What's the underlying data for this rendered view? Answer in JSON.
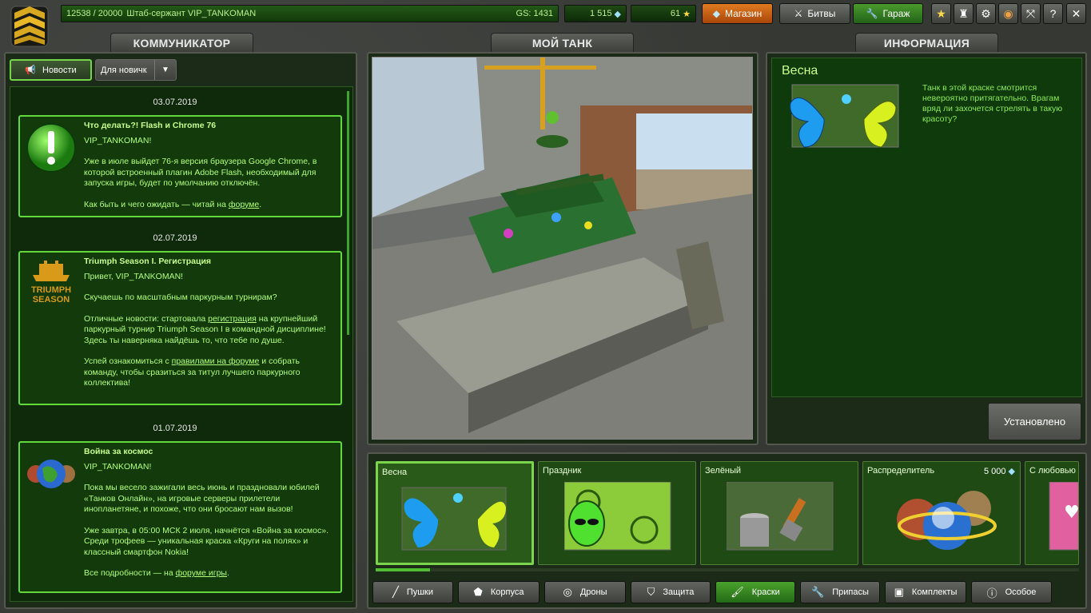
{
  "header": {
    "xp": "12538 / 20000",
    "player": "Штаб-сержант VIP_TANKOMAN",
    "gs": "GS: 1431",
    "crystals": "1 515",
    "stars": "61",
    "shop_label": "Магазин",
    "battles_label": "Битвы",
    "garage_label": "Гараж"
  },
  "tabs": {
    "communicator": "КОММУНИКАТОР",
    "my_tank": "МОЙ ТАНК",
    "information": "ИНФОРМАЦИЯ"
  },
  "communicator": {
    "news_button": "Новости",
    "filter_value": "Для новичк",
    "posts": [
      {
        "date": "03.07.2019",
        "title": "Что делать?! Flash и Chrome 76",
        "greeting": "VIP_TANKOMAN!",
        "body1": "Уже в июле выйдет 76-я версия браузера Google Chrome, в которой встроенный плагин Adobe Flash, необходимый для запуска игры, будет по умолчанию отключён.",
        "body2_pre": "Как быть и чего ожидать — читай на ",
        "body2_link": "форуме",
        "body2_post": "."
      },
      {
        "date": "02.07.2019",
        "title": "Triumph Season I. Регистрация",
        "greeting": "Привет, VIP_TANKOMAN!",
        "body1": "Скучаешь по масштабным паркурным турнирам?",
        "body2_pre": "Отличные новости: стартовала ",
        "body2_link": "регистрация",
        "body2_post": " на крупнейший паркурный турнир Triumph Season I в командной дисциплине! Здесь ты наверняка найдёшь то, что тебе по душе.",
        "body3_pre": "Успей ознакомиться с ",
        "body3_link": "правилами на форуме",
        "body3_post": " и собрать команду, чтобы сразиться за титул лучшего паркурного коллектива!",
        "logo_text1": "TRIUMPH",
        "logo_text2": "SEASON"
      },
      {
        "date": "01.07.2019",
        "title": "Война за космос",
        "greeting": "VIP_TANKOMAN!",
        "body1": "Пока мы весело зажигали весь июнь и праздновали юбилей «Танков Онлайн», на игровые серверы прилетели инопланетяне, и похоже, что они бросают нам вызов!",
        "body2": "Уже завтра, в 05:00 МСК 2 июля, начнётся «Война за космос». Среди трофеев — уникальная краска «Круги на полях» и классный смартфон Nokia!",
        "body3_pre": "Все подробности — на ",
        "body3_link": "форуме игры",
        "body3_post": "."
      }
    ]
  },
  "info": {
    "title": "Весна",
    "description": "Танк в этой краске смотрится невероятно притягательно. Врагам вряд ли захочется стрелять в такую красоту?",
    "installed_button": "Установлено"
  },
  "items": [
    {
      "label": "Весна",
      "price": "",
      "selected": true
    },
    {
      "label": "Праздник",
      "price": "",
      "selected": false
    },
    {
      "label": "Зелёный",
      "price": "",
      "selected": false
    },
    {
      "label": "Распределитель",
      "price": "5 000",
      "selected": false
    },
    {
      "label": "С любовью",
      "price": "",
      "selected": false
    }
  ],
  "categories": [
    {
      "label": "Пушки",
      "active": false
    },
    {
      "label": "Корпуса",
      "active": false
    },
    {
      "label": "Дроны",
      "active": false
    },
    {
      "label": "Защита",
      "active": false
    },
    {
      "label": "Краски",
      "active": true
    },
    {
      "label": "Припасы",
      "active": false
    },
    {
      "label": "Комплекты",
      "active": false
    },
    {
      "label": "Особое",
      "active": false
    }
  ],
  "colors": {
    "accent_green": "#62d83d",
    "shop_orange": "#e07a20",
    "panel_bg": "#0f2a0a"
  }
}
